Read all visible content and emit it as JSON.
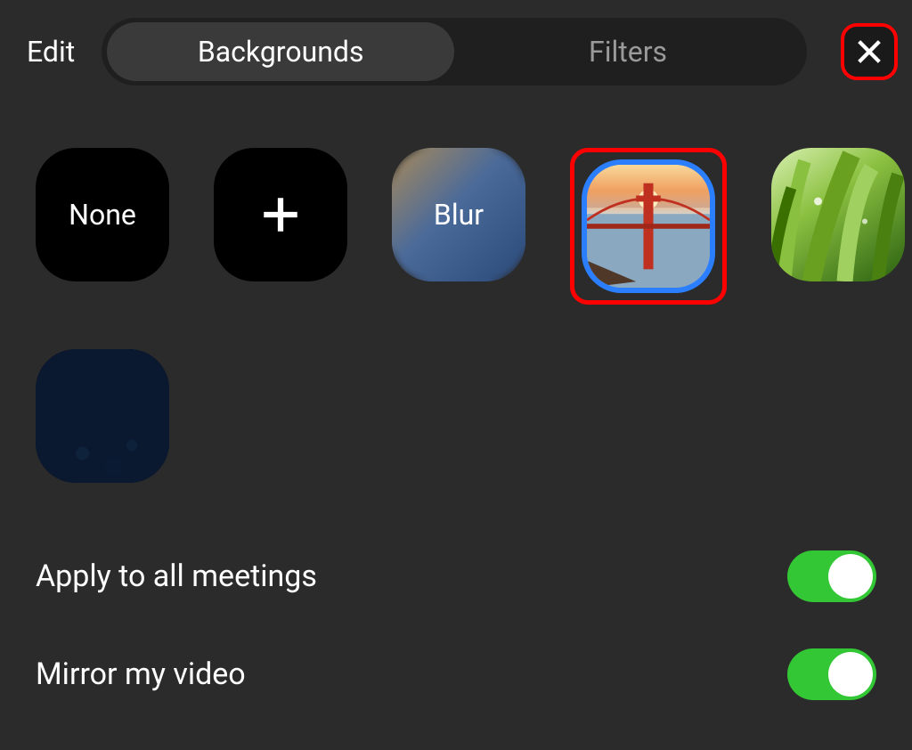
{
  "header": {
    "edit_label": "Edit"
  },
  "tabs": {
    "active": "Backgrounds",
    "items": [
      {
        "label": "Backgrounds"
      },
      {
        "label": "Filters"
      }
    ]
  },
  "backgrounds": {
    "selected_index": 3,
    "items": [
      {
        "type": "none",
        "label": "None"
      },
      {
        "type": "add",
        "label": ""
      },
      {
        "type": "blur",
        "label": "Blur"
      },
      {
        "type": "image",
        "name": "golden-gate-bridge"
      },
      {
        "type": "image",
        "name": "grass"
      },
      {
        "type": "image",
        "name": "space-earth"
      }
    ]
  },
  "settings": {
    "apply_all": {
      "label": "Apply to all meetings",
      "value": true
    },
    "mirror": {
      "label": "Mirror my video",
      "value": true
    }
  },
  "highlights": {
    "close_button": true,
    "selected_background": true
  }
}
